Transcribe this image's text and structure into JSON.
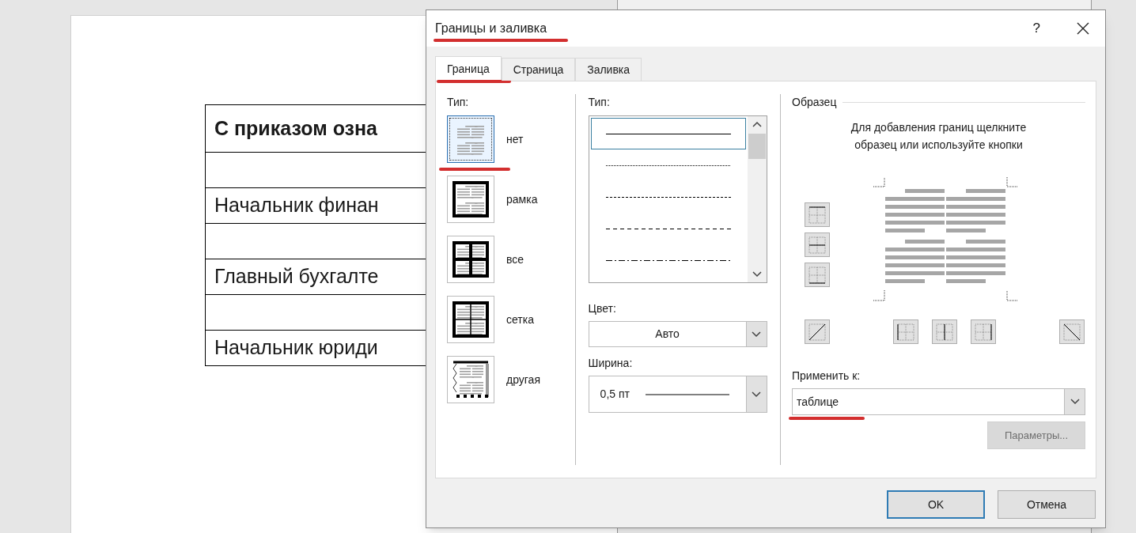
{
  "document": {
    "table_rows": [
      {
        "kind": "text",
        "text": "С приказом озна",
        "bold": true
      },
      {
        "kind": "blank"
      },
      {
        "kind": "text",
        "text": "Начальник финан",
        "bold": false
      },
      {
        "kind": "blank"
      },
      {
        "kind": "text",
        "text": "Главный бухгалте",
        "bold": false
      },
      {
        "kind": "blank"
      },
      {
        "kind": "text",
        "text": "Начальник юриди",
        "bold": false
      }
    ]
  },
  "dialog": {
    "title": "Границы и заливка",
    "title_highlighted": true,
    "help": "?",
    "tabs": [
      {
        "label": "Граница",
        "selected": true,
        "highlighted": true
      },
      {
        "label": "Страница",
        "selected": false,
        "highlighted": false
      },
      {
        "label": "Заливка",
        "selected": false,
        "highlighted": false
      }
    ],
    "setting": {
      "label": "Тип:",
      "items": [
        {
          "kind": "none",
          "label": "нет",
          "selected": true,
          "highlighted": true
        },
        {
          "kind": "box",
          "label": "рамка",
          "selected": false,
          "highlighted": false
        },
        {
          "kind": "all",
          "label": "все",
          "selected": false,
          "highlighted": false
        },
        {
          "kind": "grid",
          "label": "сетка",
          "selected": false,
          "highlighted": false
        },
        {
          "kind": "custom",
          "label": "другая",
          "selected": false,
          "highlighted": false
        }
      ]
    },
    "style": {
      "label": "Тип:",
      "line_styles": [
        {
          "kind": "solid",
          "selected": true
        },
        {
          "kind": "dotted",
          "selected": false
        },
        {
          "kind": "fine-dashed",
          "selected": false
        },
        {
          "kind": "dashed",
          "selected": false
        },
        {
          "kind": "dash-dot",
          "selected": false
        }
      ],
      "color_label": "Цвет:",
      "color_value": "Авто",
      "width_label": "Ширина:",
      "width_value": "0,5 пт"
    },
    "preview": {
      "label": "Образец",
      "hint": "Для добавления границ щелкните образец или используйте кнопки",
      "apply_label": "Применить к:",
      "apply_value": "таблице",
      "apply_highlighted": true,
      "options_button": "Параметры...",
      "options_disabled": true
    },
    "buttons": [
      {
        "label": "OK",
        "focused": true
      },
      {
        "label": "Отмена",
        "focused": false
      }
    ]
  }
}
